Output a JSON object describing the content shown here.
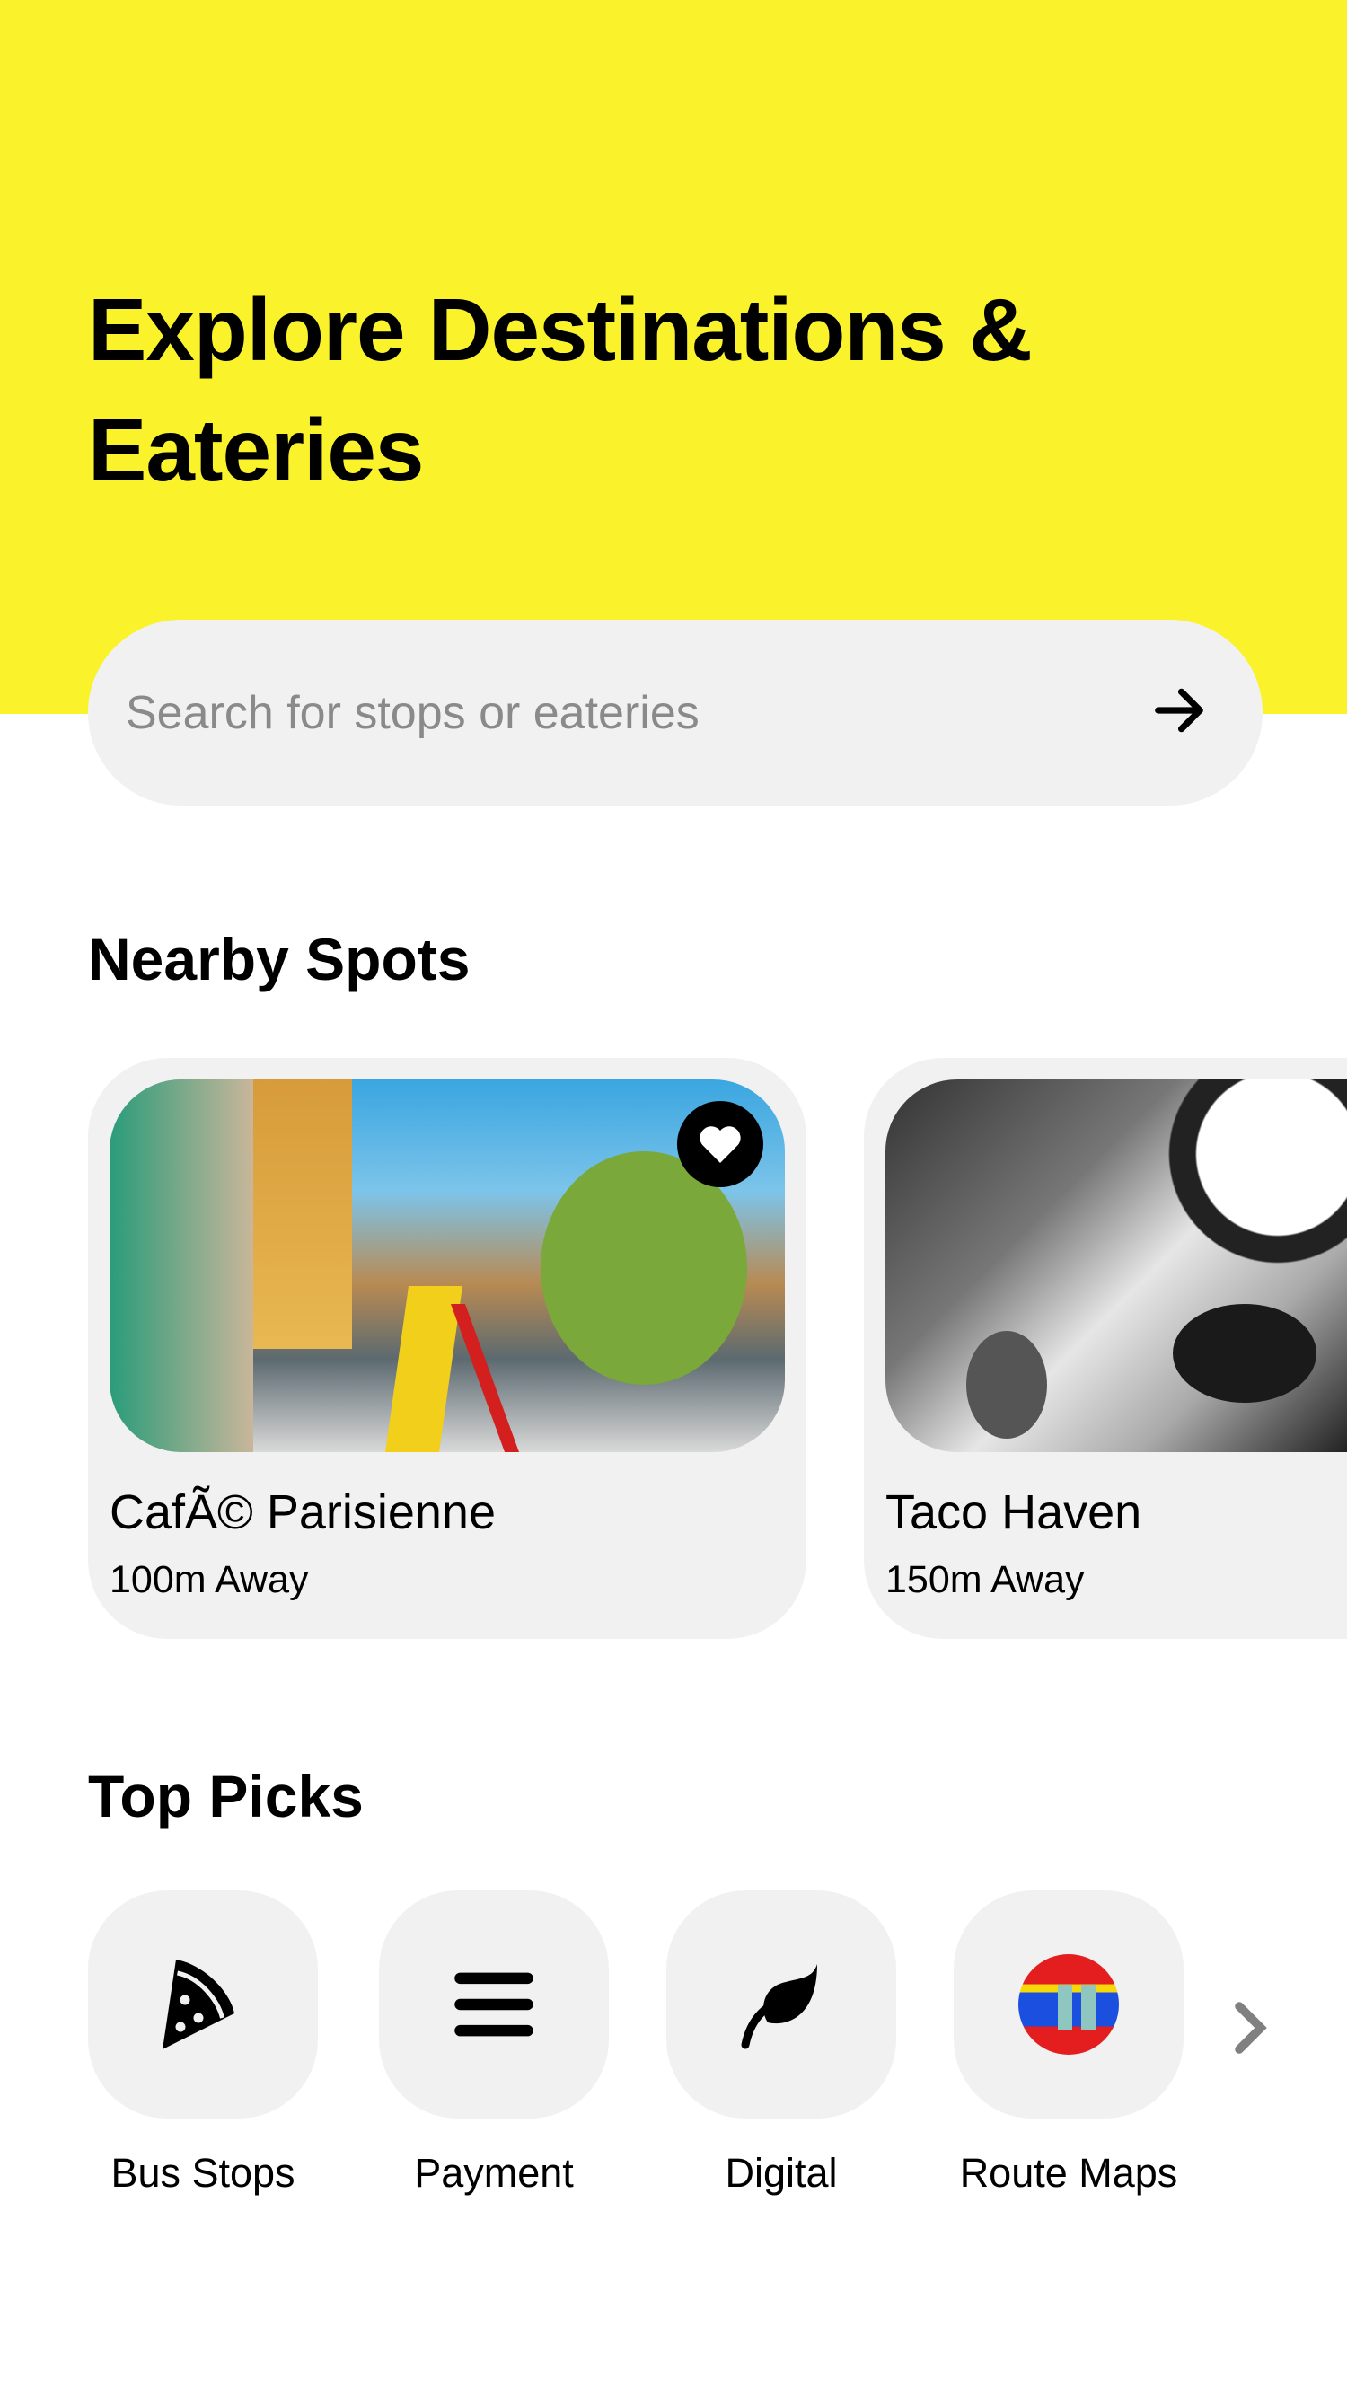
{
  "header": {
    "title": "Explore Destinations & Eateries",
    "background": "#faf22a"
  },
  "search": {
    "placeholder": "Search for stops or eateries",
    "submit_icon": "arrow-right-icon"
  },
  "nearby": {
    "heading": "Nearby Spots",
    "cards": [
      {
        "name": "CafÃ© Parisienne",
        "distance": "100m Away",
        "favorite": true
      },
      {
        "name": "Taco Haven",
        "distance": "150m Away",
        "favorite": false
      }
    ]
  },
  "top_picks": {
    "heading": "Top Picks",
    "items": [
      {
        "label": "Bus Stops",
        "icon": "pizza-slice-icon"
      },
      {
        "label": "Payment",
        "icon": "menu-bars-icon"
      },
      {
        "label": "Digital",
        "icon": "leaf-icon"
      },
      {
        "label": "Route Maps",
        "icon": "route-map-thumbnail"
      }
    ],
    "more_icon": "chevron-right-icon"
  }
}
